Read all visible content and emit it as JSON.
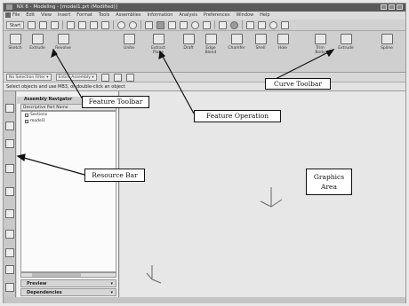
{
  "window": {
    "title": "NX 6 - Modeling - [model1.prt (Modified)]"
  },
  "menubar": {
    "items": [
      "File",
      "Edit",
      "View",
      "Insert",
      "Format",
      "Tools",
      "Assemblies",
      "Information",
      "Analysis",
      "Preferences",
      "Window",
      "Help"
    ]
  },
  "std_toolbar": {
    "start_label": "Start"
  },
  "feature_toolbar": {
    "buttons": [
      {
        "label": "Sketch",
        "label2": ""
      },
      {
        "label": "Extrude",
        "label2": ""
      },
      {
        "label": "Revolve",
        "label2": ""
      },
      {
        "label": "Unite",
        "label2": ""
      },
      {
        "label": "Extract",
        "label2": "Plane"
      },
      {
        "label": "Draft",
        "label2": ""
      },
      {
        "label": "Edge Blend",
        "label2": ""
      },
      {
        "label": "Chamfer",
        "label2": ""
      },
      {
        "label": "Shell",
        "label2": ""
      },
      {
        "label": "Hole",
        "label2": ""
      },
      {
        "label": "Trim Body",
        "label2": ""
      },
      {
        "label": "Extrude",
        "label2": ""
      },
      {
        "label": "Spline",
        "label2": ""
      }
    ]
  },
  "selection_bar": {
    "filter": "No Selection Filter",
    "scope": "Entire Assembly"
  },
  "cue_line": {
    "text": "Select objects and use MB3, or double-click an object"
  },
  "navigator": {
    "title": "Assembly Navigator",
    "column_header": "Descriptive Part Name",
    "items": [
      "Sections",
      "model1"
    ],
    "preview_label": "Preview",
    "dependencies_label": "Dependencies"
  },
  "callouts": {
    "feature_toolbar": "Feature Toolbar",
    "feature_operation": "Feature Operation",
    "curve_toolbar": "Curve Toolbar",
    "resource_bar": "Resource Bar",
    "graphics_area_line1": "Graphics",
    "graphics_area_line2": "Area"
  },
  "colors": {
    "title_bar": "#5a5a5a",
    "toolbar_bg": "#cfcfcf",
    "graphics_bg": "#e7e7e7",
    "callout_border": "#111111"
  }
}
